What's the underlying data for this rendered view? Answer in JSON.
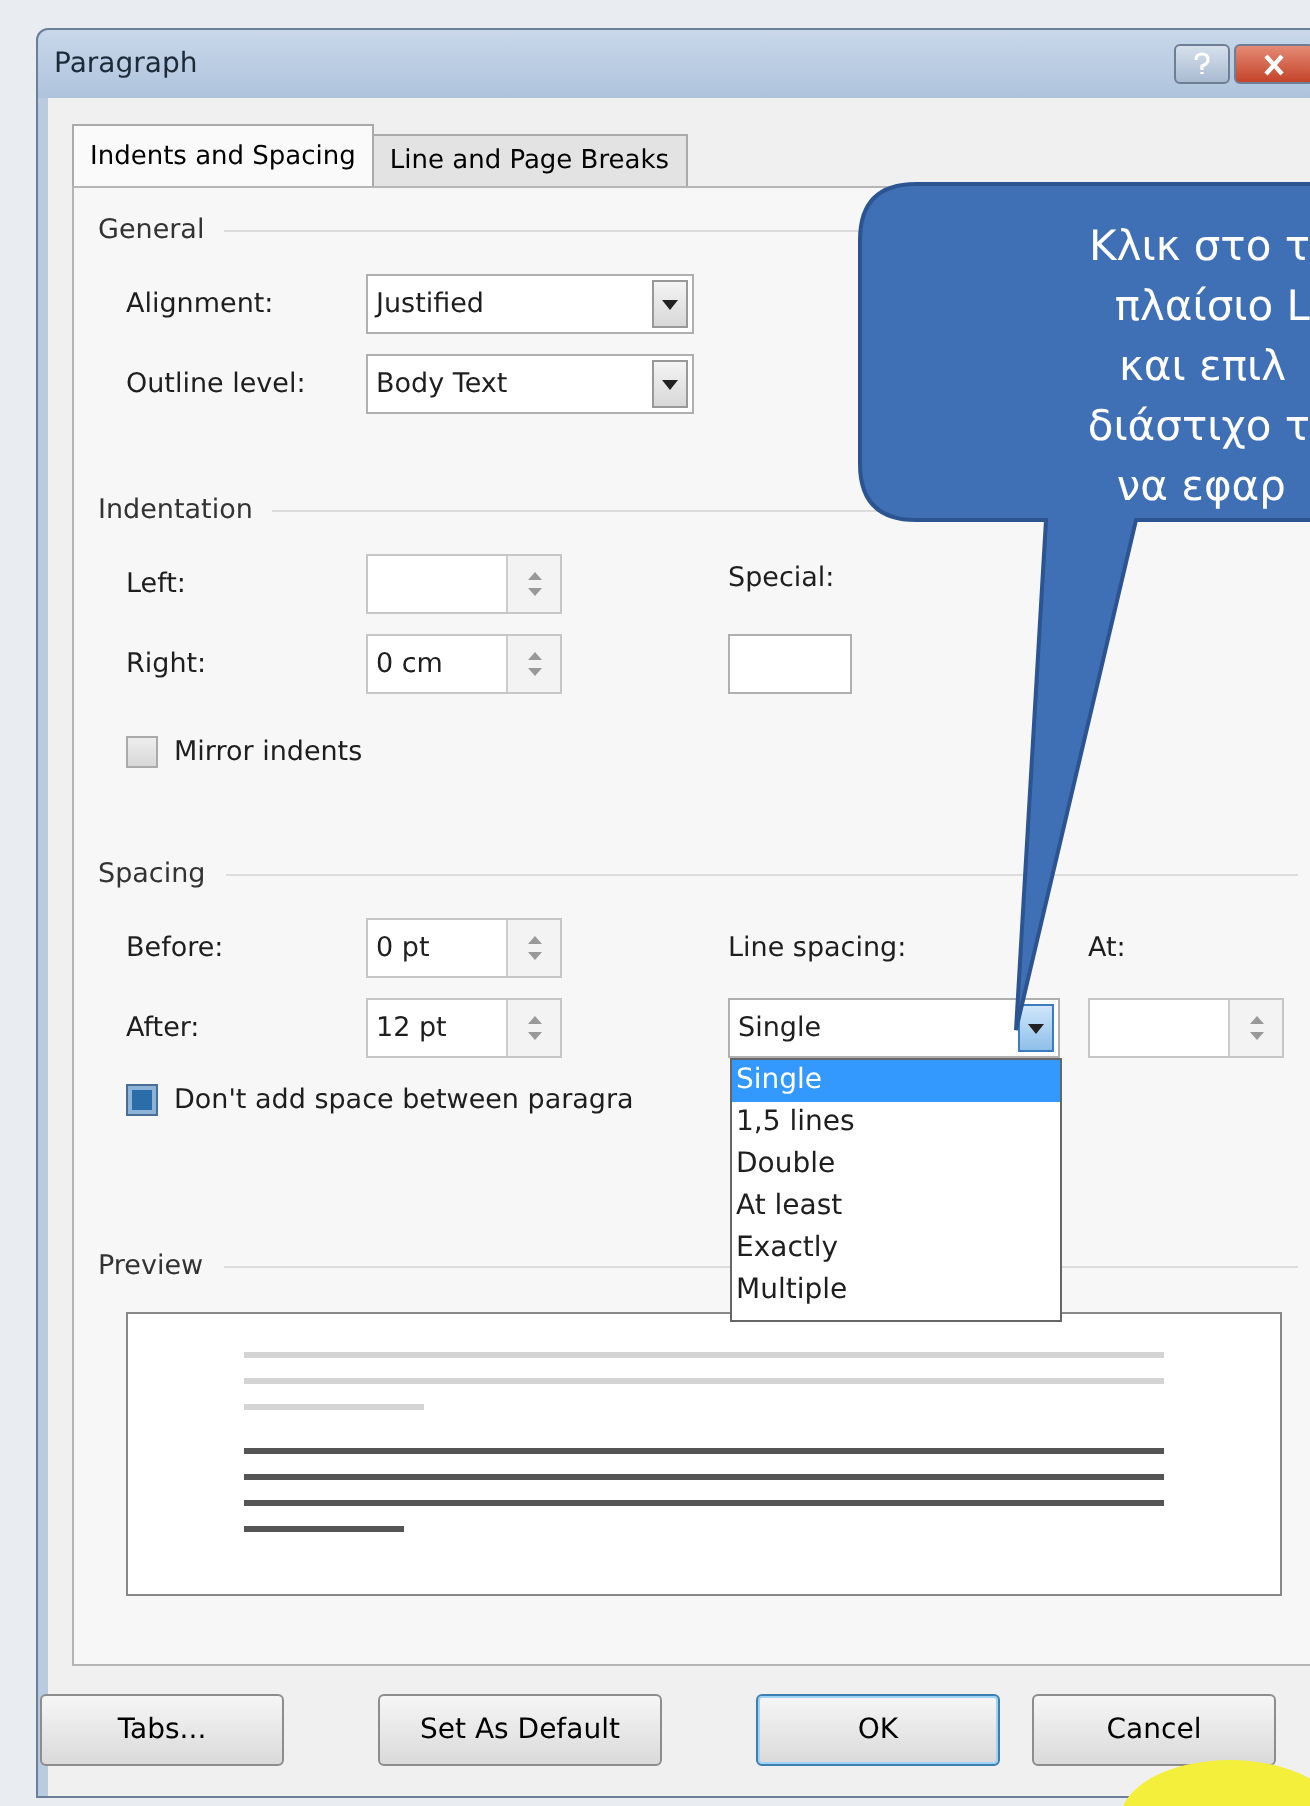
{
  "window": {
    "title": "Paragraph"
  },
  "tabs": [
    {
      "label": "Indents and Spacing",
      "selected": true
    },
    {
      "label": "Line and Page Breaks",
      "selected": false
    }
  ],
  "general": {
    "title": "General",
    "alignment": {
      "label": "Alignment:",
      "value": "Justified"
    },
    "outline_level": {
      "label": "Outline level:",
      "value": "Body Text"
    }
  },
  "indentation": {
    "title": "Indentation",
    "left": {
      "label": "Left:"
    },
    "right": {
      "label": "Right:",
      "value": "0 cm"
    },
    "special": {
      "label": "Special:"
    },
    "mirror_indents": {
      "label": "Mirror indents",
      "checked": false
    }
  },
  "spacing": {
    "title": "Spacing",
    "before": {
      "label": "Before:",
      "value": "0 pt"
    },
    "after": {
      "label": "After:",
      "value": "12 pt"
    },
    "line_spacing": {
      "label": "Line spacing:",
      "value": "Single",
      "expanded": true,
      "options": [
        {
          "label": "Single",
          "selected": true
        },
        {
          "label": "1,5 lines",
          "selected": false
        },
        {
          "label": "Double",
          "selected": false
        },
        {
          "label": "At least",
          "selected": false
        },
        {
          "label": "Exactly",
          "selected": false
        },
        {
          "label": "Multiple",
          "selected": false
        }
      ]
    },
    "at": {
      "label": "At:"
    },
    "dont_add_space": {
      "label": "Don't add space between paragra",
      "checked": true
    }
  },
  "preview": {
    "title": "Preview"
  },
  "buttons": [
    {
      "label": "Tabs...",
      "default": false
    },
    {
      "label": "Set As Default",
      "default": false
    },
    {
      "label": "OK",
      "default": true
    },
    {
      "label": "Cancel",
      "default": false
    }
  ],
  "callout": {
    "lines": [
      "Κλικ στο τ",
      "πλαίσιο L",
      "και επιλ",
      "διάστιχο τ",
      "να εφαρ"
    ]
  }
}
